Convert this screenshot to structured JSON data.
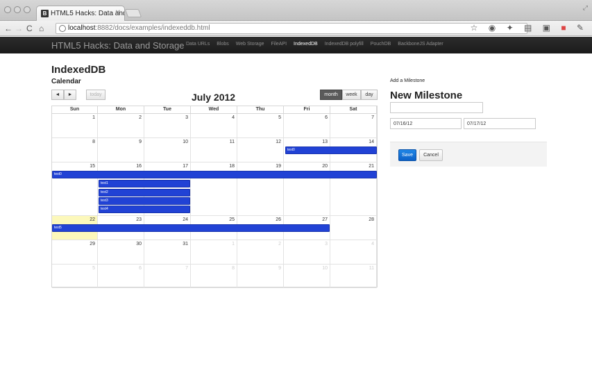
{
  "browser": {
    "tab_title": "HTML5 Hacks: Data and Sto",
    "favicon_letter": "B",
    "url_host": "localhost",
    "url_path": ":8882/docs/examples/indexeddb.html"
  },
  "site": {
    "brand": "HTML5 Hacks: Data and Storage",
    "nav": [
      "Data URLs",
      "Blobs",
      "Web Storage",
      "FileAPI",
      "IndexedDB",
      "IndexedDB polyfill",
      "PouchDB",
      "BackboneJS Adapter"
    ],
    "active_nav": "IndexedDB"
  },
  "page": {
    "heading": "IndexedDB",
    "subheading": "Calendar"
  },
  "calendar": {
    "prev_label": "◄",
    "next_label": "►",
    "today_label": "today",
    "title": "July 2012",
    "view_month": "month",
    "view_week": "week",
    "view_day": "day",
    "days_of_week": [
      "Sun",
      "Mon",
      "Tue",
      "Wed",
      "Thu",
      "Fri",
      "Sat"
    ],
    "weeks": [
      [
        "1",
        "2",
        "3",
        "4",
        "5",
        "6",
        "7"
      ],
      [
        "8",
        "9",
        "10",
        "11",
        "12",
        "13",
        "14"
      ],
      [
        "15",
        "16",
        "17",
        "18",
        "19",
        "20",
        "21"
      ],
      [
        "22",
        "23",
        "24",
        "25",
        "26",
        "27",
        "28"
      ],
      [
        "29",
        "30",
        "31",
        "1",
        "2",
        "3",
        "4"
      ],
      [
        "5",
        "6",
        "7",
        "8",
        "9",
        "10",
        "11"
      ]
    ],
    "events": [
      "test0",
      "test0",
      "test1",
      "test2",
      "test3",
      "test4",
      "test5"
    ]
  },
  "milestone_form": {
    "section_label": "Add a Milestone",
    "heading": "New Milestone",
    "title_value": "",
    "start_date": "07/16/12",
    "end_date": "07/17/12",
    "save_label": "Save",
    "cancel_label": "Cancel"
  }
}
